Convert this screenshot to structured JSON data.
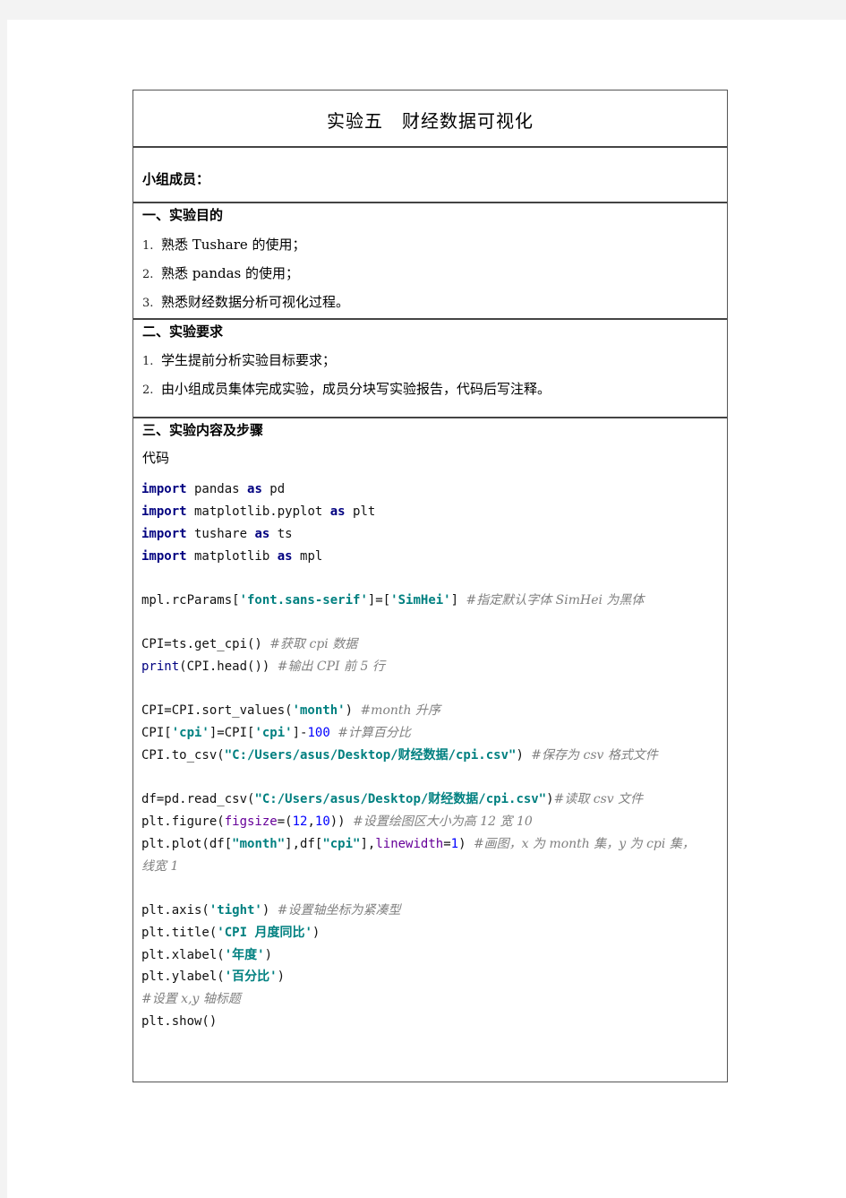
{
  "document": {
    "title": "实验五　财经数据可视化",
    "members_label": "小组成员：",
    "sections": [
      {
        "heading": "一、实验目的",
        "items": [
          {
            "num": "1.",
            "text": "熟悉 Tushare 的使用；"
          },
          {
            "num": "2.",
            "text": "熟悉 pandas 的使用；"
          },
          {
            "num": "3.",
            "text": "熟悉财经数据分析可视化过程。"
          }
        ]
      },
      {
        "heading": "二、实验要求",
        "items": [
          {
            "num": "1.",
            "text": "学生提前分析实验目标要求；"
          },
          {
            "num": "2.",
            "text": "由小组成员集体完成实验，成员分块写实验报告，代码后写注释。"
          }
        ]
      },
      {
        "heading": "三、实验内容及步骤",
        "sub_label": "代码"
      }
    ],
    "code": {
      "l1": {
        "kw": "import",
        "a": " pandas ",
        "kw2": "as",
        "b": " pd"
      },
      "l2": {
        "kw": "import",
        "a": " matplotlib.pyplot ",
        "kw2": "as",
        "b": " plt"
      },
      "l3": {
        "kw": "import",
        "a": " tushare ",
        "kw2": "as",
        "b": " ts"
      },
      "l4": {
        "kw": "import",
        "a": " matplotlib ",
        "kw2": "as",
        "b": " mpl"
      },
      "l5": {
        "a": "mpl.rcParams[",
        "s1": "'font.sans-serif'",
        "b": "]=[",
        "s2": "'SimHei'",
        "c": "] ",
        "cm": "#指定默认字体 SimHei 为黑体"
      },
      "l6": {
        "a": "CPI=ts.get_cpi() ",
        "cm": "#获取 cpi 数据"
      },
      "l7": {
        "bi": "print",
        "a": "(CPI.head()) ",
        "cm": "#输出 CPI 前 5 行"
      },
      "l8": {
        "a": "CPI=CPI.sort_values(",
        "s1": "'month'",
        "b": ") ",
        "cm": "#month 升序"
      },
      "l9": {
        "a": "CPI[",
        "s1": "'cpi'",
        "b": "]=CPI[",
        "s2": "'cpi'",
        "c": "]-",
        "n1": "100",
        "d": " ",
        "cm": "#计算百分比"
      },
      "l10": {
        "a": "CPI.to_csv(",
        "s1": "\"C:/Users/asus/Desktop/财经数据/cpi.csv\"",
        "b": ") ",
        "cm": "#保存为 csv 格式文件"
      },
      "l11": {
        "a": "df=pd.read_csv(",
        "s1": "\"C:/Users/asus/Desktop/财经数据/cpi.csv\"",
        "b": ")",
        "cm": "#读取 csv 文件"
      },
      "l12": {
        "a": "plt.figure(",
        "kw": "figsize",
        "b": "=(",
        "n1": "12",
        "c": ",",
        "n2": "10",
        "d": ")) ",
        "cm": "#设置绘图区大小为高 12 宽 10"
      },
      "l13": {
        "a": "plt.plot(df[",
        "s1": "\"month\"",
        "b": "],df[",
        "s2": "\"cpi\"",
        "c": "],",
        "kw": "linewidth",
        "d": "=",
        "n1": "1",
        "e": ") ",
        "cm": "#画图，x 为 month 集，y 为 cpi 集，"
      },
      "l13b": {
        "cm": "线宽 1"
      },
      "l14": {
        "a": "plt.axis(",
        "s1": "'tight'",
        "b": ") ",
        "cm": "#设置轴坐标为紧凑型"
      },
      "l15": {
        "a": "plt.title(",
        "s1": "'CPI 月度同比'",
        "b": ")"
      },
      "l16": {
        "a": "plt.xlabel(",
        "s1": "'年度'",
        "b": ")"
      },
      "l17": {
        "a": "plt.ylabel(",
        "s1": "'百分比'",
        "b": ")"
      },
      "l18": {
        "cm": "#设置 x,y 轴标题"
      },
      "l19": {
        "a": "plt.show()"
      }
    }
  }
}
